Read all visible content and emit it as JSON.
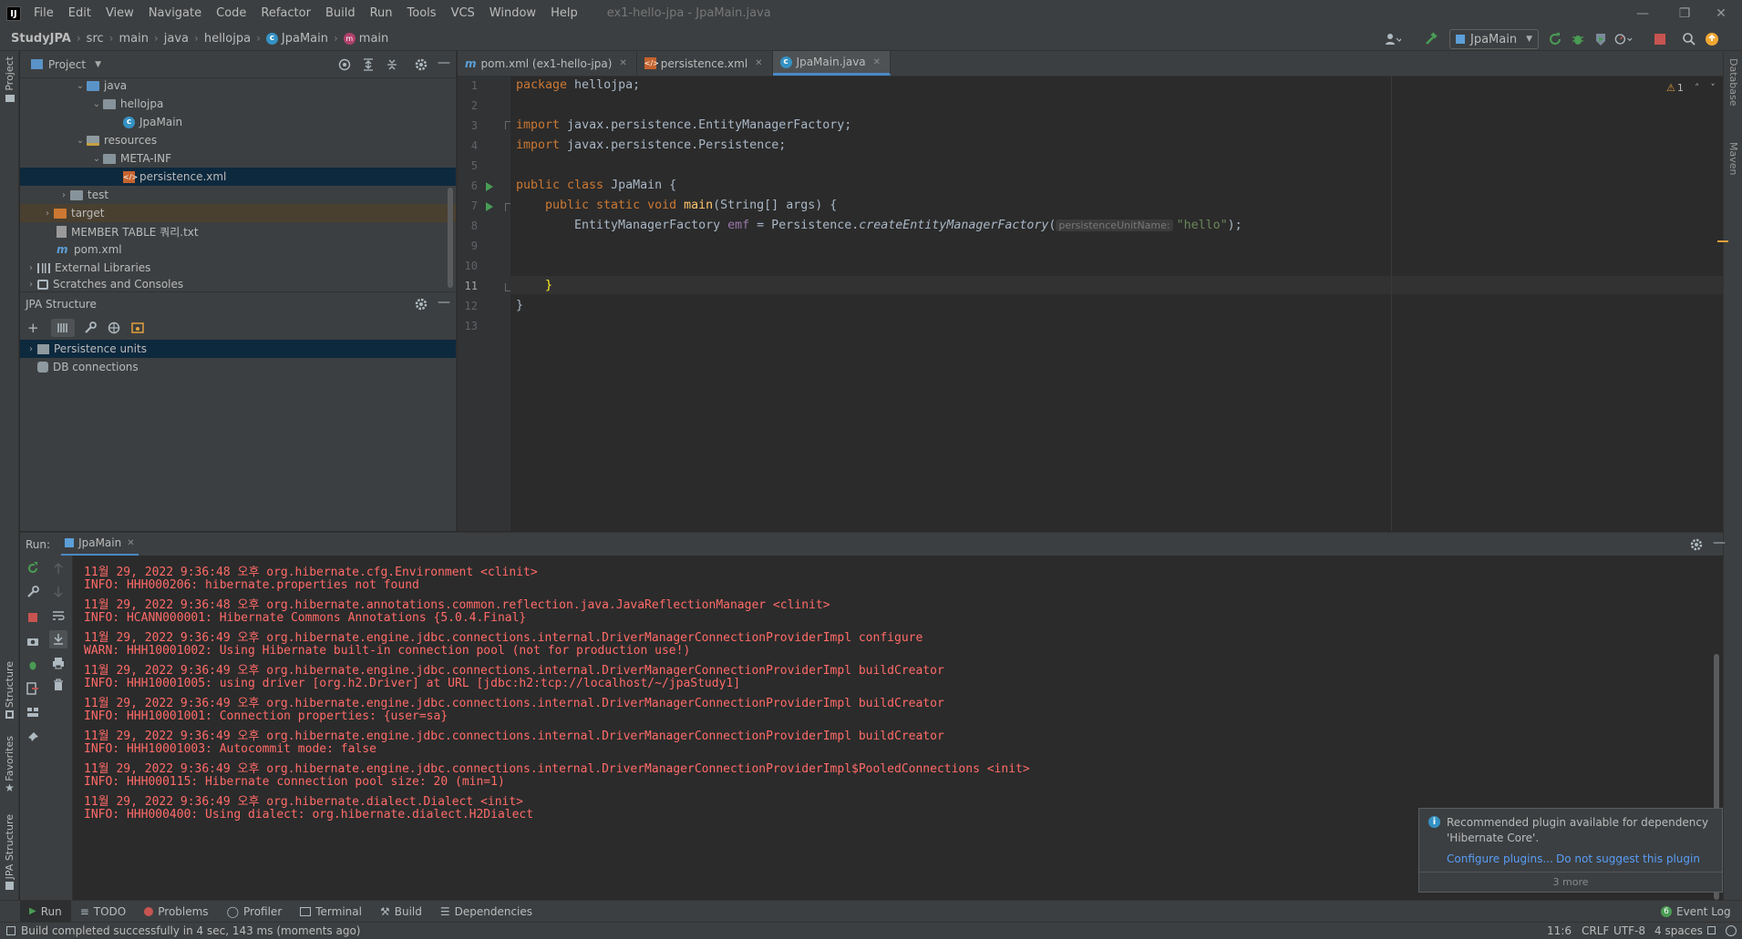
{
  "window": {
    "logo": "IJ",
    "title": "ex1-hello-jpa - JpaMain.java"
  },
  "menu": [
    "File",
    "Edit",
    "View",
    "Navigate",
    "Code",
    "Refactor",
    "Build",
    "Run",
    "Tools",
    "VCS",
    "Window",
    "Help"
  ],
  "breadcrumbs": [
    "StudyJPA",
    "src",
    "main",
    "java",
    "hellojpa",
    "JpaMain",
    "main"
  ],
  "run_config": "JpaMain",
  "project_panel": {
    "title": "Project",
    "tree": [
      {
        "label": "java",
        "depth": 3,
        "expanded": true,
        "icon": "folder-blue"
      },
      {
        "label": "hellojpa",
        "depth": 4,
        "expanded": true,
        "icon": "package"
      },
      {
        "label": "JpaMain",
        "depth": 5,
        "icon": "java-class"
      },
      {
        "label": "resources",
        "depth": 3,
        "expanded": true,
        "icon": "folder-resources"
      },
      {
        "label": "META-INF",
        "depth": 4,
        "expanded": true,
        "icon": "folder"
      },
      {
        "label": "persistence.xml",
        "depth": 5,
        "icon": "xml-file",
        "selected": true
      },
      {
        "label": "test",
        "depth": 2,
        "expanded": false,
        "icon": "folder"
      },
      {
        "label": "target",
        "depth": 1,
        "expanded": false,
        "icon": "folder-excluded"
      },
      {
        "label": "MEMBER TABLE 쿼리.txt",
        "depth": 1,
        "icon": "text-file"
      },
      {
        "label": "pom.xml",
        "depth": 1,
        "icon": "maven-file"
      },
      {
        "label": "External Libraries",
        "depth": 0,
        "expanded": false,
        "icon": "libraries"
      },
      {
        "label": "Scratches and Consoles",
        "depth": 0,
        "expanded": false,
        "icon": "scratches"
      }
    ]
  },
  "jpa_panel": {
    "title": "JPA Structure",
    "items": [
      {
        "label": "Persistence units",
        "selected": true
      },
      {
        "label": "DB connections",
        "selected": false
      }
    ]
  },
  "left_stripe": {
    "project": "Project",
    "structure": "Structure",
    "favorites": "Favorites",
    "jpa_structure": "JPA Structure"
  },
  "right_stripe": {
    "database": "Database",
    "maven": "Maven"
  },
  "editor": {
    "tabs": [
      {
        "label": "pom.xml (ex1-hello-jpa)",
        "icon": "m",
        "active": false
      },
      {
        "label": "persistence.xml",
        "icon": "xml",
        "active": false
      },
      {
        "label": "JpaMain.java",
        "icon": "class",
        "active": true
      }
    ],
    "line_numbers": [
      "1",
      "2",
      "3",
      "4",
      "5",
      "6",
      "7",
      "8",
      "9",
      "10",
      "11",
      "12",
      "13"
    ],
    "current_line": "11",
    "warnings_count": "1",
    "code": {
      "l1_kw": "package",
      "l1_rest": " hellojpa;",
      "l3_kw": "import",
      "l3_rest": " javax.persistence.EntityManagerFactory;",
      "l4_kw": "import",
      "l4_rest": " javax.persistence.Persistence;",
      "l6_kw": "public class",
      "l6_rest": " JpaMain {",
      "l7_kw": "public static void",
      "l7_name": " main",
      "l7_rest": "(String[] args) {",
      "l8_type": "EntityManagerFactory ",
      "l8_var": "emf",
      "l8_mid": " = Persistence.",
      "l8_method": "createEntityManagerFactory",
      "l8_paren": "(",
      "l8_hint": "persistenceUnitName:",
      "l8_str": "\"hello\"",
      "l8_end": ");",
      "l11": "}",
      "l12": "}"
    }
  },
  "run_panel": {
    "label": "Run:",
    "tab": "JpaMain",
    "console": [
      "11월 29, 2022 9:36:48 오후 org.hibernate.cfg.Environment <clinit>",
      "INFO: HHH000206: hibernate.properties not found",
      "11월 29, 2022 9:36:48 오후 org.hibernate.annotations.common.reflection.java.JavaReflectionManager <clinit>",
      "INFO: HCANN000001: Hibernate Commons Annotations {5.0.4.Final}",
      "11월 29, 2022 9:36:49 오후 org.hibernate.engine.jdbc.connections.internal.DriverManagerConnectionProviderImpl configure",
      "WARN: HHH10001002: Using Hibernate built-in connection pool (not for production use!)",
      "11월 29, 2022 9:36:49 오후 org.hibernate.engine.jdbc.connections.internal.DriverManagerConnectionProviderImpl buildCreator",
      "INFO: HHH10001005: using driver [org.h2.Driver] at URL [jdbc:h2:tcp://localhost/~/jpaStudy1]",
      "11월 29, 2022 9:36:49 오후 org.hibernate.engine.jdbc.connections.internal.DriverManagerConnectionProviderImpl buildCreator",
      "INFO: HHH10001001: Connection properties: {user=sa}",
      "11월 29, 2022 9:36:49 오후 org.hibernate.engine.jdbc.connections.internal.DriverManagerConnectionProviderImpl buildCreator",
      "INFO: HHH10001003: Autocommit mode: false",
      "11월 29, 2022 9:36:49 오후 org.hibernate.engine.jdbc.connections.internal.DriverManagerConnectionProviderImpl$PooledConnections <init>",
      "INFO: HHH000115: Hibernate connection pool size: 20 (min=1)",
      "11월 29, 2022 9:36:49 오후 org.hibernate.dialect.Dialect <init>",
      "INFO: HHH000400: Using dialect: org.hibernate.dialect.H2Dialect"
    ]
  },
  "notification": {
    "line1": "Recommended plugin available for dependency",
    "line2": "'Hibernate Core'.",
    "action1": "Configure plugins...",
    "action2": "Do not suggest this plugin",
    "more": "3 more"
  },
  "bottom_tools": [
    "Run",
    "TODO",
    "Problems",
    "Profiler",
    "Terminal",
    "Build",
    "Dependencies"
  ],
  "event_log": "Event Log",
  "event_log_count": "6",
  "status": {
    "message": "Build completed successfully in 4 sec, 143 ms (moments ago)",
    "position": "11:6",
    "line_sep": "CRLF",
    "encoding": "UTF-8",
    "indent": "4 spaces"
  },
  "colors": {
    "accent": "#4a88c7",
    "console_error": "#ff6b68",
    "keyword": "#cc7832",
    "string": "#6a8759",
    "run_green": "#499c54",
    "stop_red": "#c75450"
  }
}
